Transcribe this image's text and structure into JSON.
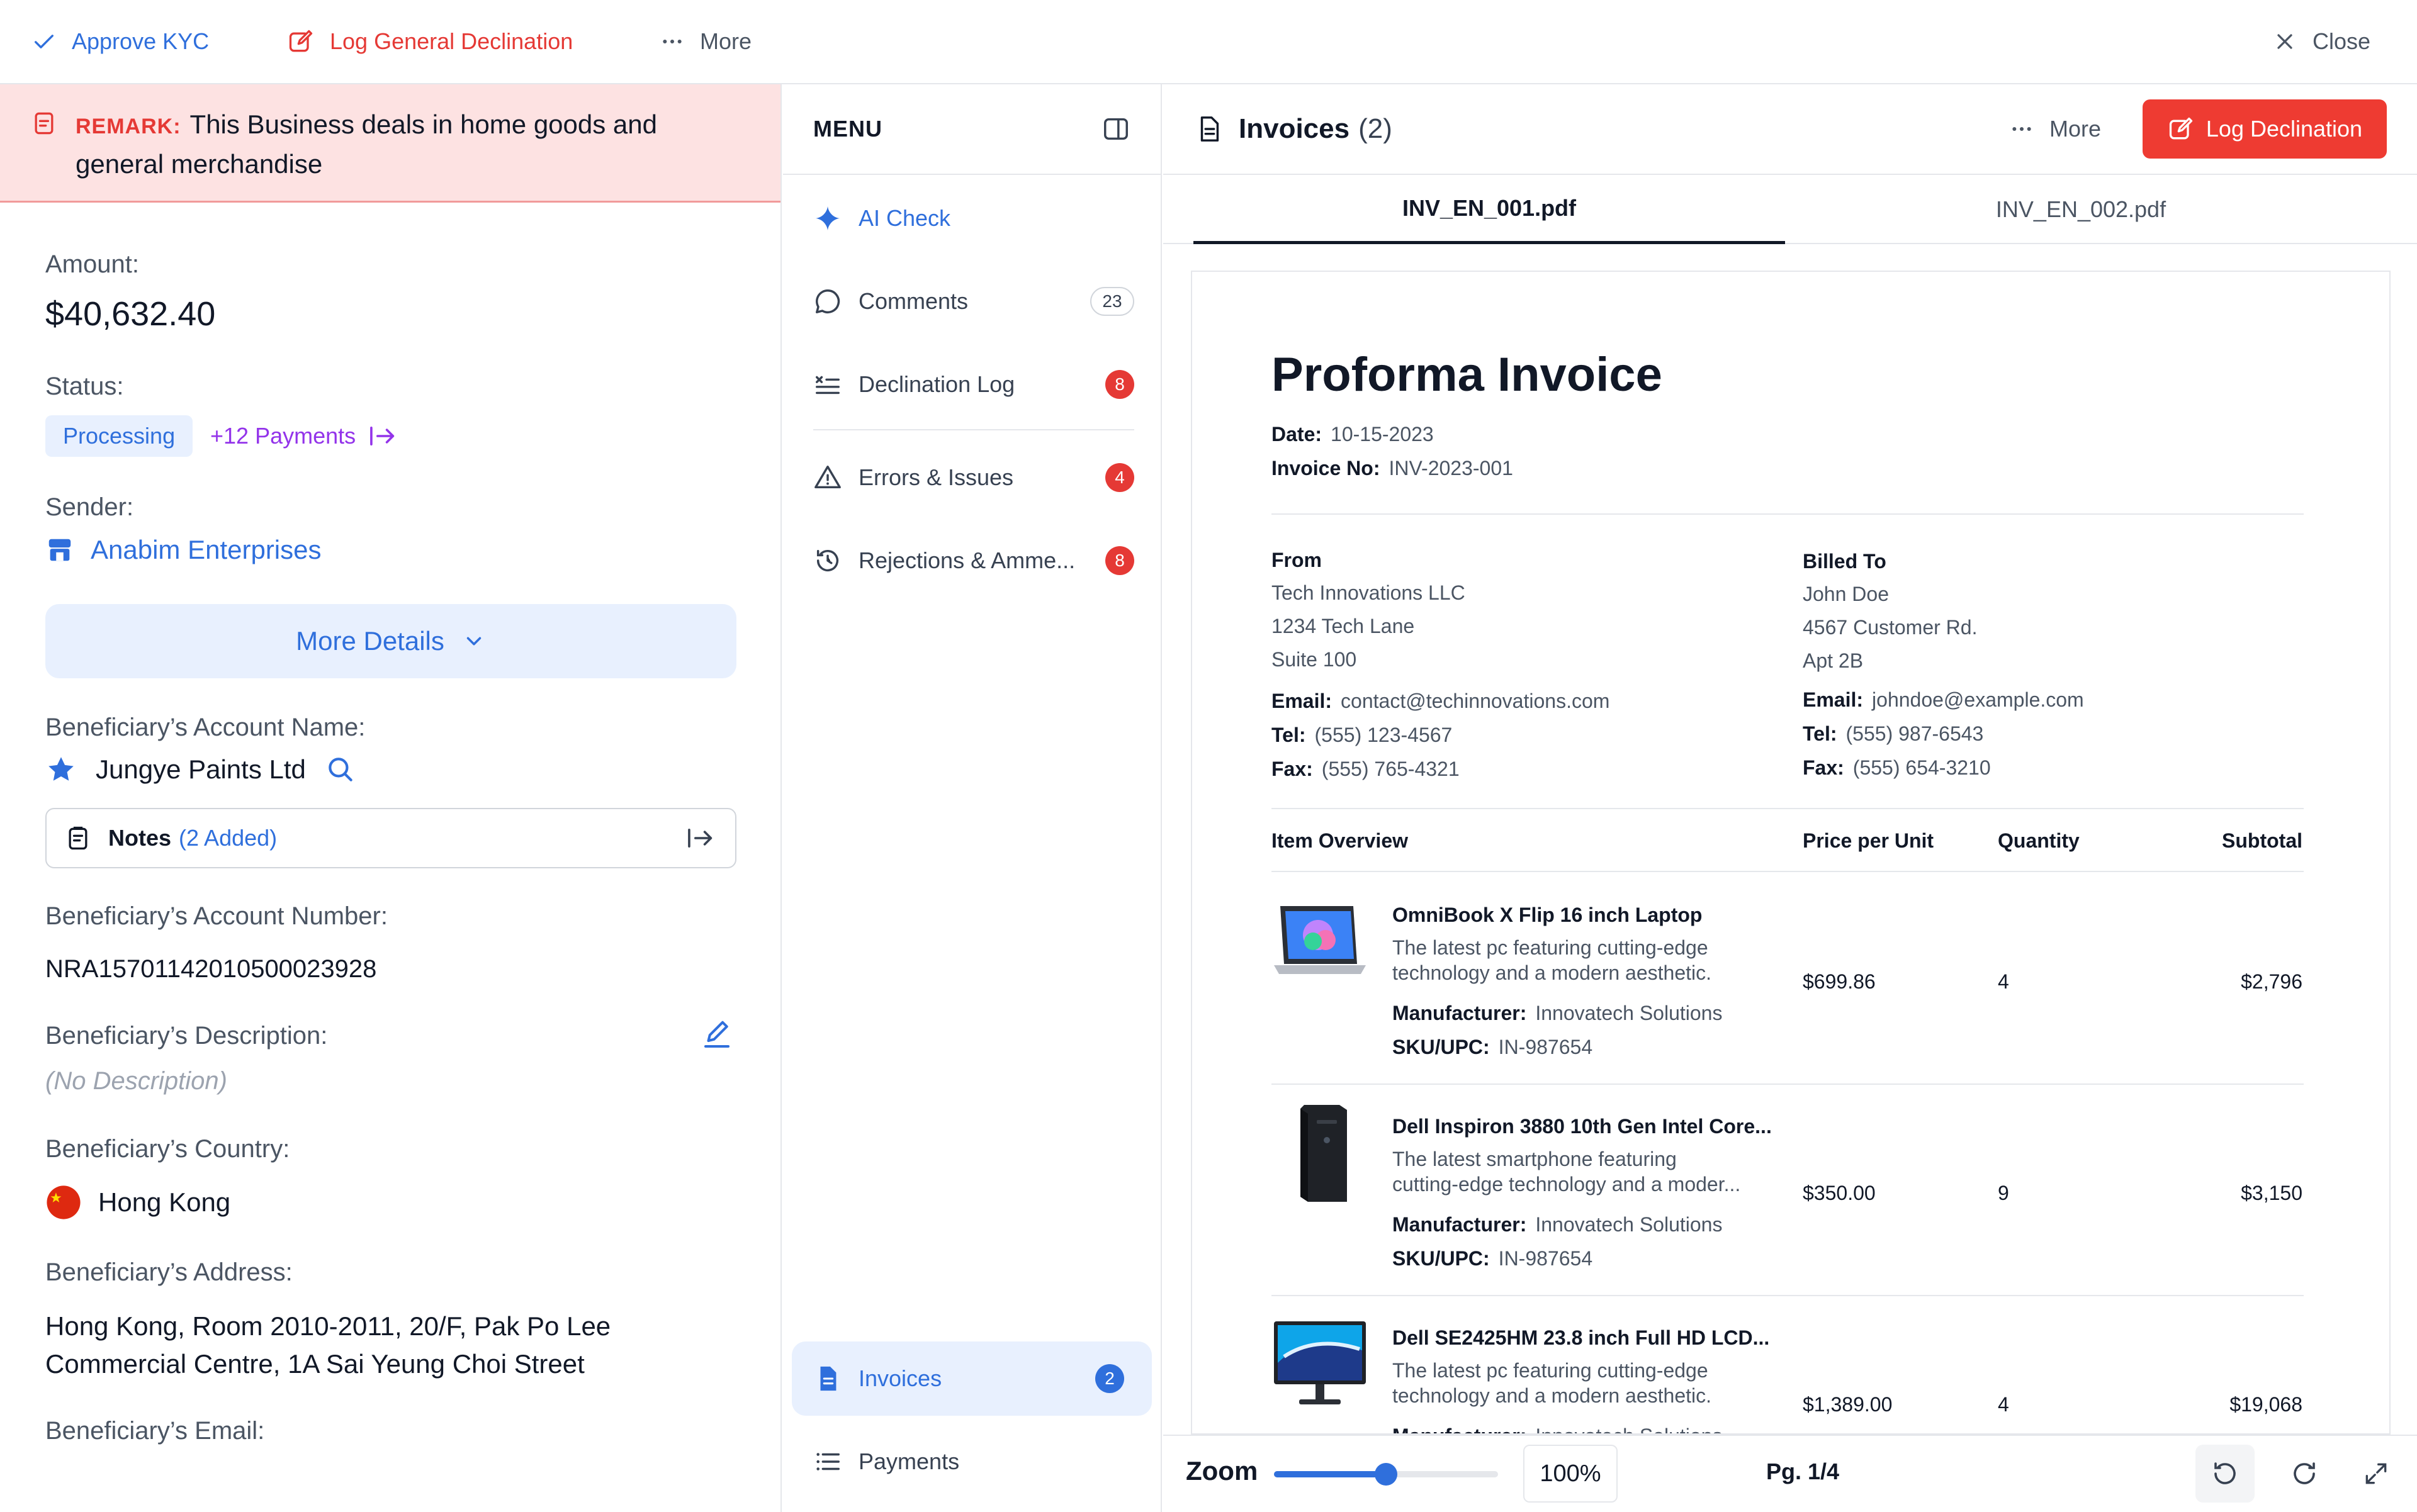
{
  "topbar": {
    "approve_label": "Approve KYC",
    "log_general_label": "Log General Declination",
    "more_label": "More",
    "close_label": "Close"
  },
  "remark": {
    "tag": "REMARK:",
    "text_line1": "This Business deals in home goods and",
    "text_line2": "general merchandise"
  },
  "details": {
    "amount_label": "Amount:",
    "amount_value": "$40,632.40",
    "status_label": "Status:",
    "status_value": "Processing",
    "payments_link": "+12 Payments",
    "sender_label": "Sender:",
    "sender_value": "Anabim Enterprises",
    "more_details": "More Details",
    "ben_name_label": "Beneficiary’s Account Name:",
    "ben_name_value": "Jungye Paints Ltd",
    "notes_label": "Notes",
    "notes_count": "(2 Added)",
    "ben_number_label": "Beneficiary’s Account Number:",
    "ben_number_value": "NRA15701142010500023928",
    "ben_desc_label": "Beneficiary’s Description:",
    "ben_desc_value": "(No Description)",
    "ben_country_label": "Beneficiary’s Country:",
    "ben_country_value": "Hong Kong",
    "ben_address_label": "Beneficiary’s Address:",
    "ben_address_line1": "Hong Kong, Room 2010-2011, 20/F, Pak Po Lee",
    "ben_address_line2": "Commercial Centre, 1A Sai Yeung Choi Street",
    "ben_email_label": "Beneficiary’s Email:"
  },
  "menu": {
    "title": "MENU",
    "items": [
      {
        "label": "AI Check",
        "badge": ""
      },
      {
        "label": "Comments",
        "badge": "23"
      },
      {
        "label": "Declination Log",
        "badge": "8"
      },
      {
        "label": "Errors & Issues",
        "badge": "4"
      },
      {
        "label": "Rejections & Amme...",
        "badge": "8"
      },
      {
        "label": "Invoices",
        "badge": "2"
      },
      {
        "label": "Payments",
        "badge": ""
      }
    ]
  },
  "viewer": {
    "title": "Invoices",
    "count": "(2)",
    "more_label": "More",
    "log_label": "Log Declination",
    "tabs": [
      "INV_EN_001.pdf",
      "INV_EN_002.pdf"
    ],
    "zoom_label": "Zoom",
    "zoom_value": "100%",
    "zoom_fraction": 0.5,
    "page": "Pg. 1/4"
  },
  "invoice": {
    "title": "Proforma Invoice",
    "date_label": "Date:",
    "date": "10-15-2023",
    "no_label": "Invoice No:",
    "no": "INV-2023-001",
    "from_label": "From",
    "from_lines": [
      "Tech Innovations LLC",
      "1234 Tech Lane",
      "Suite 100"
    ],
    "from_email": "contact@techinnovations.com",
    "from_tel": "(555) 123-4567",
    "from_fax": "(555) 765-4321",
    "to_label": "Billed To",
    "to_lines": [
      "John Doe",
      "4567 Customer Rd.",
      "Apt 2B"
    ],
    "to_email": "johndoe@example.com",
    "to_tel": "(555) 987-6543",
    "to_fax": "(555) 654-3210",
    "email_label": "Email:",
    "tel_label": "Tel:",
    "fax_label": "Fax:",
    "headers": [
      "Item Overview",
      "Price per Unit",
      "Quantity",
      "Subtotal"
    ],
    "mfr_label": "Manufacturer:",
    "sku_label": "SKU/UPC:",
    "items": [
      {
        "name": "OmniBook X Flip 16 inch Laptop",
        "desc1": "The latest pc featuring cutting-edge",
        "desc2": "technology and a modern aesthetic.",
        "mfr": "Innovatech Solutions",
        "sku": "IN-987654",
        "price": "$699.86",
        "qty": "4",
        "subtotal": "$2,796"
      },
      {
        "name": "Dell Inspiron 3880 10th Gen Intel Core...",
        "desc1": "The latest smartphone featuring",
        "desc2": "cutting-edge technology and a moder...",
        "mfr": "Innovatech Solutions",
        "sku": "IN-987654",
        "price": "$350.00",
        "qty": "9",
        "subtotal": "$3,150"
      },
      {
        "name": "Dell SE2425HM 23.8 inch Full HD LCD...",
        "desc1": "The latest pc featuring cutting-edge",
        "desc2": "technology and a modern aesthetic.",
        "mfr": "Innovatech Solutions",
        "sku": "",
        "price": "$1,389.00",
        "qty": "4",
        "subtotal": "$19,068"
      }
    ]
  }
}
